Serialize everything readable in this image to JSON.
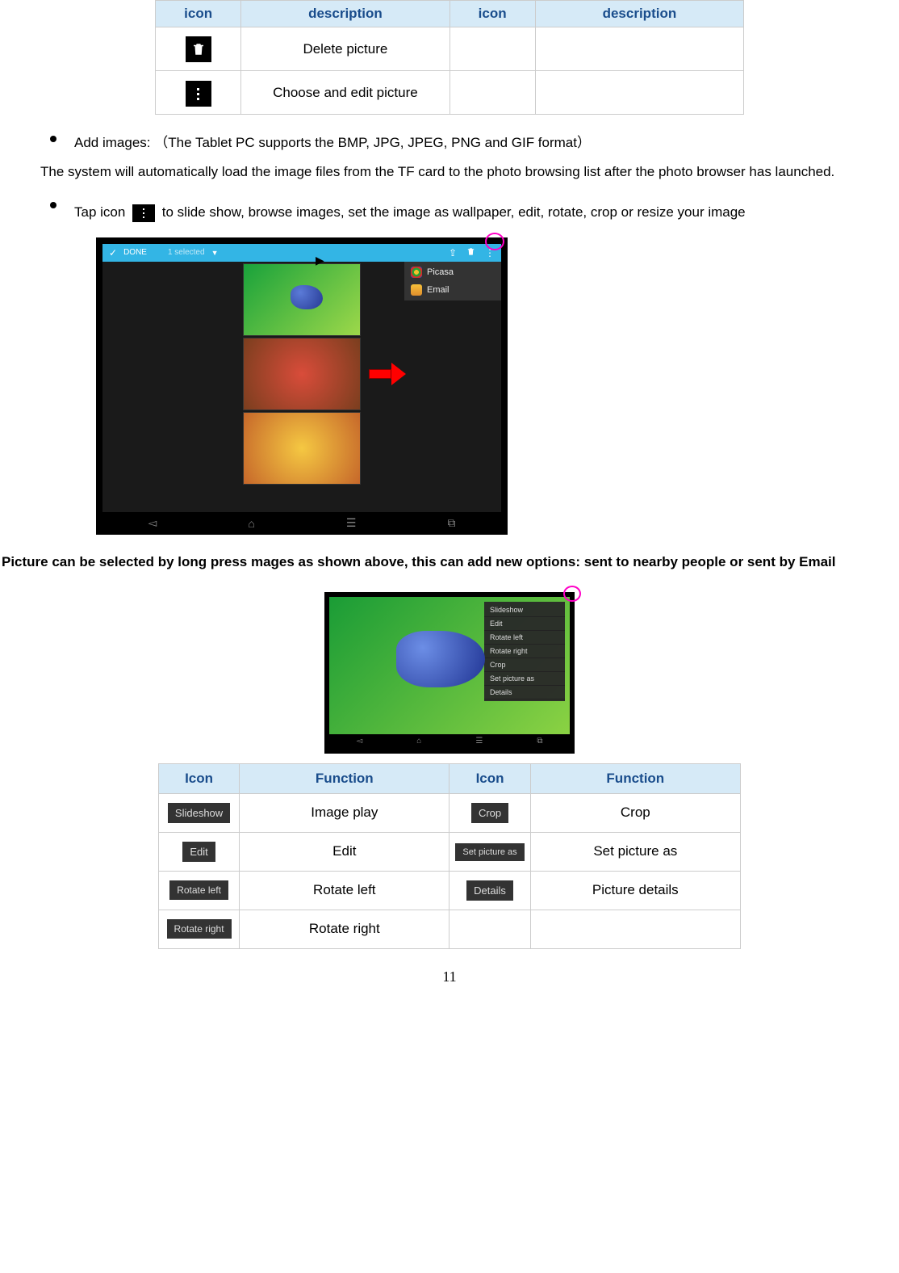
{
  "table1": {
    "headers": [
      "icon",
      "description",
      "icon",
      "description"
    ],
    "rows": [
      {
        "icon": "trash",
        "desc": "Delete picture"
      },
      {
        "icon": "more",
        "desc": "Choose and edit picture"
      }
    ]
  },
  "bullet1": {
    "pre": "Add images:",
    "post": "（The Tablet PC supports the BMP, JPG, JPEG, PNG and GIF format）"
  },
  "para1": "The system will automatically load the image files from the TF card to the photo browsing list after the photo browser has launched.",
  "bullet2": {
    "pre": "Tap icon ",
    "post": " to slide show, browse images, set the image as wallpaper, edit, rotate, crop or resize your image"
  },
  "screenshot1": {
    "done": "DONE",
    "selected": "1 selected",
    "share_items": [
      {
        "name": "Picasa",
        "icon": "picasa"
      },
      {
        "name": "Email",
        "icon": "email"
      }
    ]
  },
  "bold_para": "Picture can be selected by long press mages as shown above, this can add new options: sent to nearby people or sent by Email",
  "screenshot2": {
    "menu": [
      "Slideshow",
      "Edit",
      "Rotate left",
      "Rotate right",
      "Crop",
      "Set picture as",
      "Details"
    ]
  },
  "table2": {
    "headers": [
      "Icon",
      "Function",
      "Icon",
      "Function"
    ],
    "rows": [
      {
        "i1": "Slideshow",
        "f1": "Image play",
        "i2": "Crop",
        "f2": "Crop"
      },
      {
        "i1": "Edit",
        "f1": "Edit",
        "i2": "Set picture as",
        "f2": "Set picture as"
      },
      {
        "i1": "Rotate left",
        "f1": "Rotate left",
        "i2": "Details",
        "f2": "Picture details"
      },
      {
        "i1": "Rotate right",
        "f1": "Rotate right",
        "i2": "",
        "f2": ""
      }
    ]
  },
  "page_number": "11"
}
